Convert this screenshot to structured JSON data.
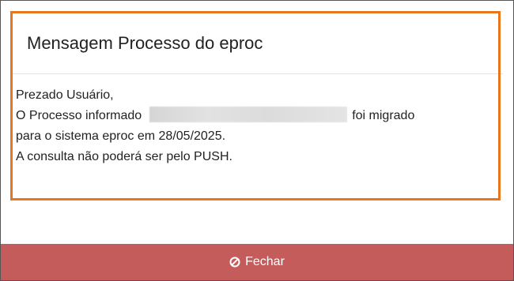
{
  "modal": {
    "title": "Mensagem Processo do eproc",
    "lines": [
      "Prezado Usuário,",
      "O Processo informado",
      "foi migrado",
      "para o sistema eproc em 28/05/2025.",
      "A consulta não poderá ser pelo PUSH."
    ],
    "footer_button": {
      "label": "Fechar",
      "icon": "ban-icon"
    }
  },
  "colors": {
    "highlight": "#e8761d",
    "button": "#c45c5c"
  }
}
